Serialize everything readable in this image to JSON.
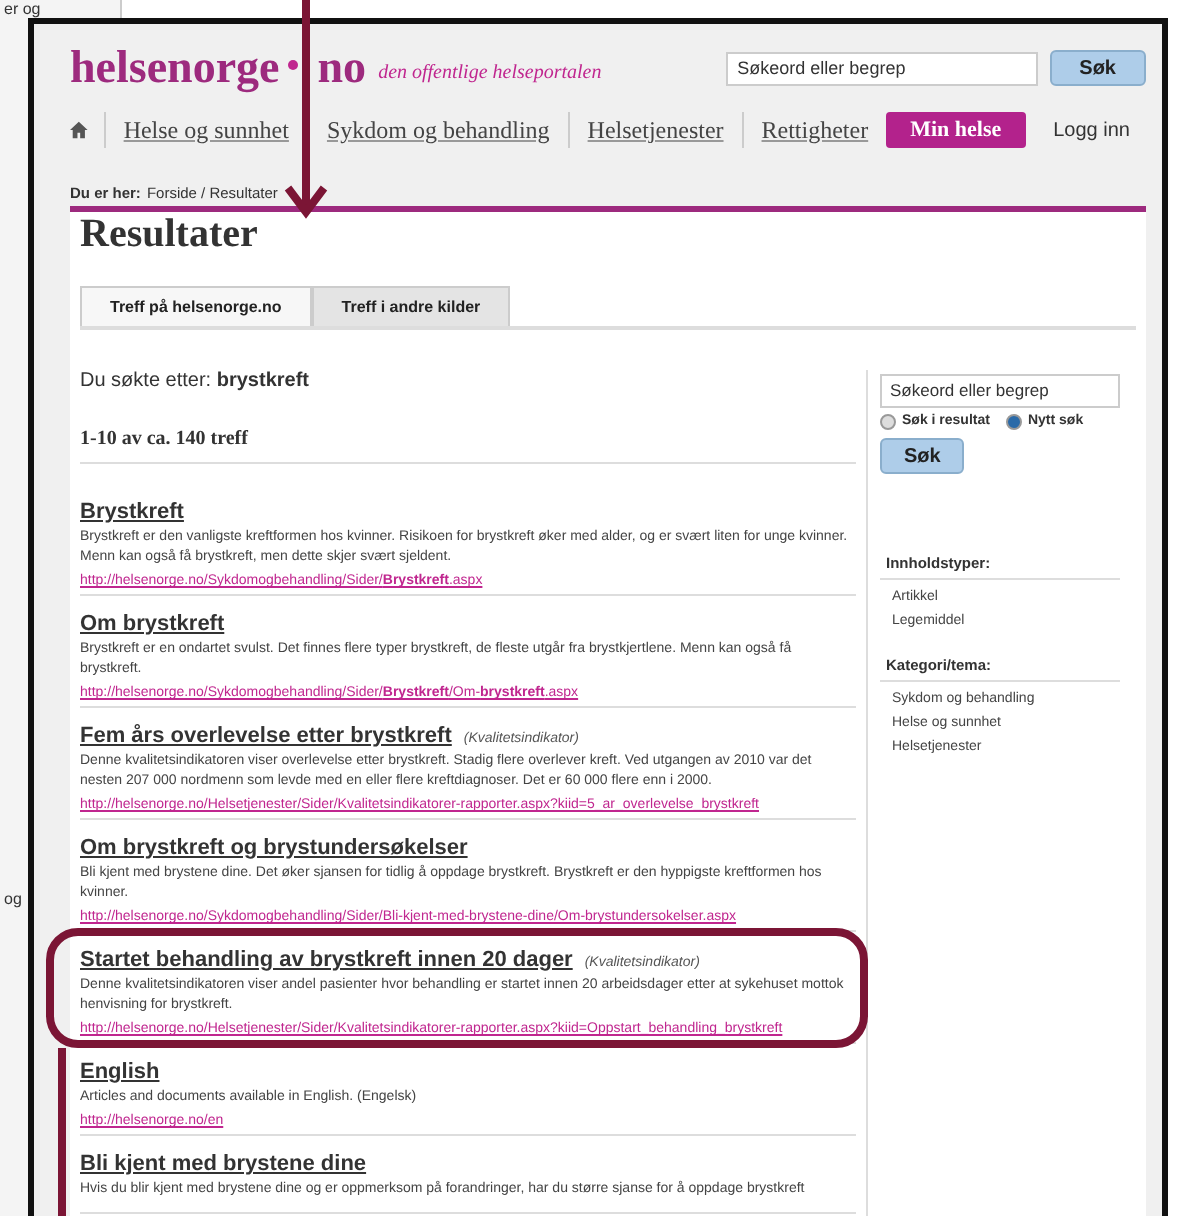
{
  "background_window": {
    "texts": [
      "er og",
      "og"
    ]
  },
  "header": {
    "logo": "helsenorge",
    "logo_suffix": "no",
    "tagline": "den offentlige helseportalen",
    "search": {
      "placeholder": "Søkeord eller begrep"
    },
    "search_button": "Søk"
  },
  "nav": {
    "items": [
      {
        "label": "Helse og sunnhet"
      },
      {
        "label": "Sykdom og behandling"
      },
      {
        "label": "Helsetjenester"
      },
      {
        "label": "Rettigheter"
      }
    ],
    "min_helse": "Min helse",
    "login": "Logg inn"
  },
  "breadcrumb": {
    "label": "Du er her:",
    "path": "Forside / Resultater"
  },
  "heading": "Resultater",
  "tabs": [
    {
      "label": "Treff på helsenorge.no",
      "selected": true
    },
    {
      "label": "Treff i andre kilder",
      "selected": false
    }
  ],
  "query": "Du søkte etter: **brystkreft**",
  "count": "1-10 av ca. 140 treff",
  "results": [
    {
      "title": "Brystkreft",
      "description": "Brystkreft er den vanligste kreftformen hos kvinner. Risikoen for brystkreft øker med alder, og er svært liten for unge kvinner. Menn kan også få brystkreft, men dette skjer svært sjeldent.",
      "url": "http://helsenorge.no/Sykdomogbehandling/Sider/**Brystkreft**.aspx"
    },
    {
      "title": "Om brystkreft",
      "description": "Brystkreft er en ondartet svulst. Det finnes flere typer brystkreft, de fleste utgår fra brystkjertlene. Menn kan også få brystkreft.",
      "url": "http://helsenorge.no/Sykdomogbehandling/Sider/**Brystkreft**/Om-**brystkreft**.aspx"
    },
    {
      "title": "Fem års overlevelse etter brystkreft",
      "tag": "(Kvalitetsindikator)",
      "description": "Denne kvalitetsindikatoren viser overlevelse etter brystkreft. Stadig flere overlever kreft. Ved utgangen av 2010 var det nesten 207 000 nordmenn som levde med en eller flere kreftdiagnoser. Det er 60 000 flere enn i 2000.",
      "url": "http://helsenorge.no/Helsetjenester/Sider/Kvalitetsindikatorer-rapporter.aspx?kiid=5_ar_overlevelse_brystkreft"
    },
    {
      "title": "Om brystkreft og brystundersøkelser",
      "description": "Bli kjent med brystene dine. Det øker sjansen for tidlig å oppdage brystkreft. Brystkreft er den hyppigste kreftformen hos kvinner.",
      "url": "http://helsenorge.no/Sykdomogbehandling/Sider/Bli-kjent-med-brystene-dine/Om-brystundersokelser.aspx"
    },
    {
      "title": "Startet behandling av brystkreft innen 20 dager",
      "tag": "(Kvalitetsindikator)",
      "circled": true,
      "description": "Denne kvalitetsindikatoren viser andel pasienter hvor behandling er startet innen 20 arbeidsdager etter at sykehuset mottok henvisning for brystkreft.",
      "url": "http://helsenorge.no/Helsetjenester/Sider/Kvalitetsindikatorer-rapporter.aspx?kiid=Oppstart_behandling_brystkreft"
    },
    {
      "title": "English",
      "description": "Articles and documents available in English. (Engelsk)",
      "url": "http://helsenorge.no/en"
    },
    {
      "title": "Bli kjent med brystene dine",
      "description": "Hvis du blir kjent med brystene dine og er oppmerksom på forandringer, har du større sjanse for å oppdage brystkreft"
    }
  ],
  "sidebar": {
    "search": {
      "placeholder": "Søkeord eller begrep"
    },
    "radios": [
      {
        "label": "Søk i resultat",
        "selected": false
      },
      {
        "label": "Nytt søk",
        "selected": true
      }
    ],
    "button": "Søk",
    "facets": [
      {
        "heading": "Innholdstyper:",
        "items": [
          "Artikkel",
          "Legemiddel"
        ]
      },
      {
        "heading": "Kategori/tema:",
        "items": [
          "Sykdom og behandling",
          "Helse og sunnhet",
          "Helsetjenester"
        ]
      }
    ]
  }
}
